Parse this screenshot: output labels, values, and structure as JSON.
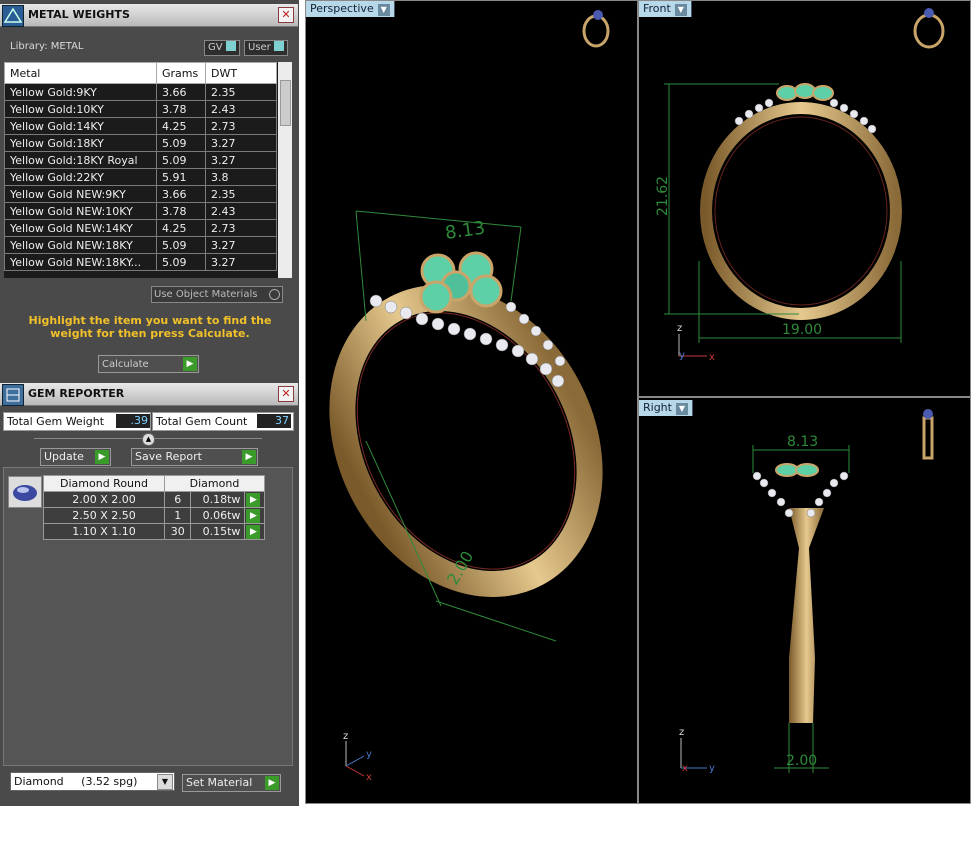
{
  "metal_weights": {
    "title": "METAL WEIGHTS",
    "close": "✕",
    "library_label": "Library: METAL",
    "toggle_gv": "GV",
    "toggle_user": "User",
    "columns": [
      "Metal",
      "Grams",
      "DWT"
    ],
    "rows": [
      [
        "Yellow Gold:9KY",
        "3.66",
        "2.35"
      ],
      [
        "Yellow Gold:10KY",
        "3.78",
        "2.43"
      ],
      [
        "Yellow Gold:14KY",
        "4.25",
        "2.73"
      ],
      [
        "Yellow Gold:18KY",
        "5.09",
        "3.27"
      ],
      [
        "Yellow Gold:18KY Royal",
        "5.09",
        "3.27"
      ],
      [
        "Yellow Gold:22KY",
        "5.91",
        "3.8"
      ],
      [
        "Yellow Gold NEW:9KY",
        "3.66",
        "2.35"
      ],
      [
        "Yellow Gold NEW:10KY",
        "3.78",
        "2.43"
      ],
      [
        "Yellow Gold NEW:14KY",
        "4.25",
        "2.73"
      ],
      [
        "Yellow Gold NEW:18KY",
        "5.09",
        "3.27"
      ],
      [
        "Yellow Gold NEW:18KY...",
        "5.09",
        "3.27"
      ]
    ],
    "use_object_materials": "Use Object Materials",
    "instruction": "Highlight the item you want to find the weight for then press Calculate.",
    "calculate": "Calculate"
  },
  "gem_reporter": {
    "title": "GEM REPORTER",
    "close": "✕",
    "total_weight_label": "Total Gem Weight",
    "total_weight_value": ".39",
    "total_count_label": "Total Gem Count",
    "total_count_value": "37",
    "update": "Update",
    "save_report": "Save Report",
    "headers": [
      "Diamond Round",
      "Diamond"
    ],
    "rows": [
      [
        "2.00 X 2.00",
        "6",
        "0.18tw"
      ],
      [
        "2.50 X 2.50",
        "1",
        "0.06tw"
      ],
      [
        "1.10 X 1.10",
        "30",
        "0.15tw"
      ]
    ],
    "material_select": "Diamond     (3.52 spg)",
    "set_material": "Set Material"
  },
  "viewports": {
    "perspective": {
      "label": "Perspective",
      "dim_top": "8.13",
      "dim_left": "",
      "dim_bottom": "2.00"
    },
    "front": {
      "label": "Front",
      "dim_height": "21.62",
      "dim_width": "19.00"
    },
    "right": {
      "label": "Right",
      "dim_top": "8.13",
      "dim_bottom": "2.00"
    }
  },
  "axes": {
    "x": "x",
    "y": "y",
    "z": "z"
  },
  "colors": {
    "panel": "#4a4a4a",
    "dim": "#2e8a3a",
    "gold": "#c9a56a",
    "gem": "#5ed0a8",
    "accent": "#f2c12a"
  }
}
